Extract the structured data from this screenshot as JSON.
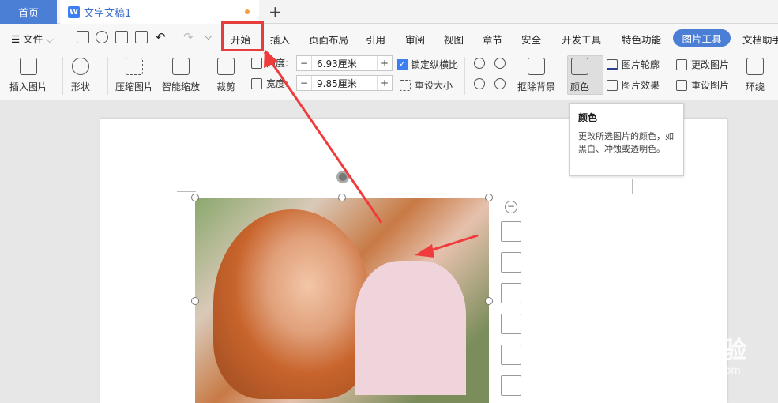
{
  "tabs": {
    "home": "首页",
    "document": "文字文稿1",
    "doc_icon": "W",
    "new_tab": "+"
  },
  "menu": {
    "file": "文件",
    "items": [
      "开始",
      "插入",
      "页面布局",
      "引用",
      "审阅",
      "视图",
      "章节",
      "安全",
      "开发工具",
      "特色功能"
    ],
    "active_tab": "图片工具",
    "last": "文档助手"
  },
  "ribbon": {
    "insert_pic": "插入图片",
    "shape": "形状",
    "compress": "压缩图片",
    "smart_zoom": "智能缩放",
    "crop": "裁剪",
    "height_label": "高度:",
    "height_value": "6.93厘米",
    "width_label": "宽度:",
    "width_value": "9.85厘米",
    "lock_ratio": "锁定纵横比",
    "reset_size": "重设大小",
    "remove_bg": "抠除背景",
    "color": "颜色",
    "pic_outline": "图片轮廓",
    "pic_effect": "图片效果",
    "change_pic": "更改图片",
    "reset_pic": "重设图片",
    "wrap": "环绕"
  },
  "tooltip": {
    "title": "颜色",
    "desc": "更改所选图片的颜色，如黑白、冲蚀或透明色。"
  },
  "watermark": {
    "brand": "Bai du 经验",
    "url": "jingyan.baidu.com"
  },
  "colors": {
    "accent": "#4b7fd6",
    "highlight": "#e53c3c",
    "unsaved_dot": "#f0a040"
  }
}
